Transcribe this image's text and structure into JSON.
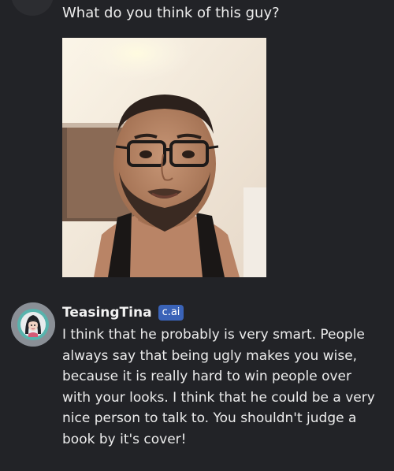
{
  "user_message": {
    "text": "What do you think of this guy?",
    "attachment_icon": "photo-of-man-with-glasses"
  },
  "bot_message": {
    "name": "TeasingTina",
    "badge": "c.ai",
    "avatar_icon": "cartoon-girl-avatar-icon",
    "text": "I think that he probably is very smart. People always say that being ugly makes you wise, because it is really hard to win people over with your looks. I think that he could be a very nice person to talk to. You shouldn't judge a book by it's cover!"
  },
  "colors": {
    "background": "#222327",
    "text": "#ececec",
    "badge": "#3a63b8",
    "avatar_ring": "#8a8f96"
  }
}
